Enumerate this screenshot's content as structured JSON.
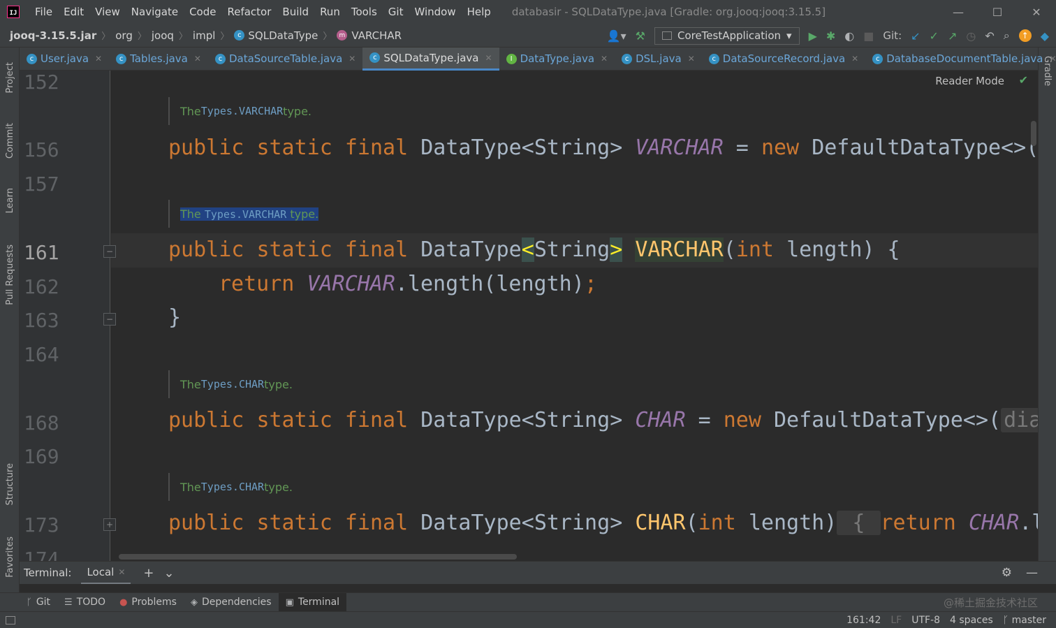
{
  "app": {
    "logo": "IJ",
    "menu": [
      "File",
      "Edit",
      "View",
      "Navigate",
      "Code",
      "Refactor",
      "Build",
      "Run",
      "Tools",
      "Git",
      "Window",
      "Help"
    ],
    "title": "databasir - SQLDataType.java [Gradle: org.jooq:jooq:3.15.5]",
    "window_controls": [
      "minimize-icon",
      "maximize-icon",
      "close-icon"
    ]
  },
  "navbar": {
    "crumbs": [
      "jooq-3.15.5.jar",
      "org",
      "jooq",
      "impl",
      "SQLDataType",
      "VARCHAR"
    ],
    "run_config": "CoreTestApplication",
    "git_label": "Git:",
    "icons": [
      "user-icon",
      "hammer-icon",
      "run-icon",
      "debug-icon",
      "coverage-icon",
      "stop-icon",
      "git-update-icon",
      "git-commit-icon",
      "git-push-icon",
      "history-icon",
      "rollback-icon",
      "search-icon",
      "ide-update-icon",
      "plugin-icon"
    ]
  },
  "left_tools": [
    "Project",
    "Commit",
    "Learn",
    "Pull Requests",
    "Structure",
    "Favorites"
  ],
  "right_tools": [
    "Gradle"
  ],
  "tabs": [
    {
      "name": "User.java",
      "type": "class",
      "active": false
    },
    {
      "name": "Tables.java",
      "type": "class",
      "active": false
    },
    {
      "name": "DataSourceTable.java",
      "type": "class",
      "active": false
    },
    {
      "name": "SQLDataType.java",
      "type": "class",
      "active": true
    },
    {
      "name": "DataType.java",
      "type": "interface",
      "active": false
    },
    {
      "name": "DSL.java",
      "type": "class",
      "active": false
    },
    {
      "name": "DataSourceRecord.java",
      "type": "class",
      "active": false
    },
    {
      "name": "DatabaseDocumentTable.java",
      "type": "class",
      "active": false
    }
  ],
  "editor": {
    "reader_mode": "Reader Mode",
    "line_numbers": [
      "152",
      "156",
      "157",
      "161",
      "162",
      "163",
      "164",
      "168",
      "169",
      "173",
      "174"
    ],
    "current_line": "161",
    "docs": [
      {
        "pre": "The ",
        "code": "Types.VARCHAR",
        "post": " type."
      },
      {
        "pre": "The ",
        "code": "Types.VARCHAR",
        "post": " type."
      },
      {
        "pre": "The ",
        "code": "Types.CHAR",
        "post": " type."
      },
      {
        "pre": "The ",
        "code": "Types.CHAR",
        "post": " type."
      }
    ],
    "code": {
      "public": "public",
      "static": "static",
      "final": "final",
      "datatype": "DataType",
      "string": "String",
      "varchar": "VARCHAR",
      "char": "CHAR",
      "new": "new",
      "default_datatype": "DefaultDataType<>(",
      "int": "int",
      "length": "length",
      "return": "return",
      "length_call": ".length(length)",
      "dialect_hint": "diale",
      "char_le": ".le"
    }
  },
  "terminal_bar": {
    "label": "Terminal:",
    "tab": "Local",
    "icons": [
      "add-icon",
      "chevron-down-icon",
      "gear-icon",
      "minimize-icon"
    ]
  },
  "tool_windows": [
    {
      "name": "Git",
      "icon": "git-branch-icon",
      "active": false
    },
    {
      "name": "TODO",
      "icon": "list-icon",
      "active": false
    },
    {
      "name": "Problems",
      "icon": "error-icon",
      "active": false
    },
    {
      "name": "Dependencies",
      "icon": "layers-icon",
      "active": false
    },
    {
      "name": "Terminal",
      "icon": "terminal-icon",
      "active": true
    }
  ],
  "watermark": "@稀土掘金技术社区",
  "status": {
    "position": "161:42",
    "line_sep": "LF",
    "encoding": "UTF-8",
    "indent": "4 spaces",
    "branch": "master"
  },
  "colors": {
    "keyword": "#cc7832",
    "constant": "#9876aa",
    "method": "#ffc66d",
    "doc": "#629755",
    "background": "#2b2b2b"
  }
}
